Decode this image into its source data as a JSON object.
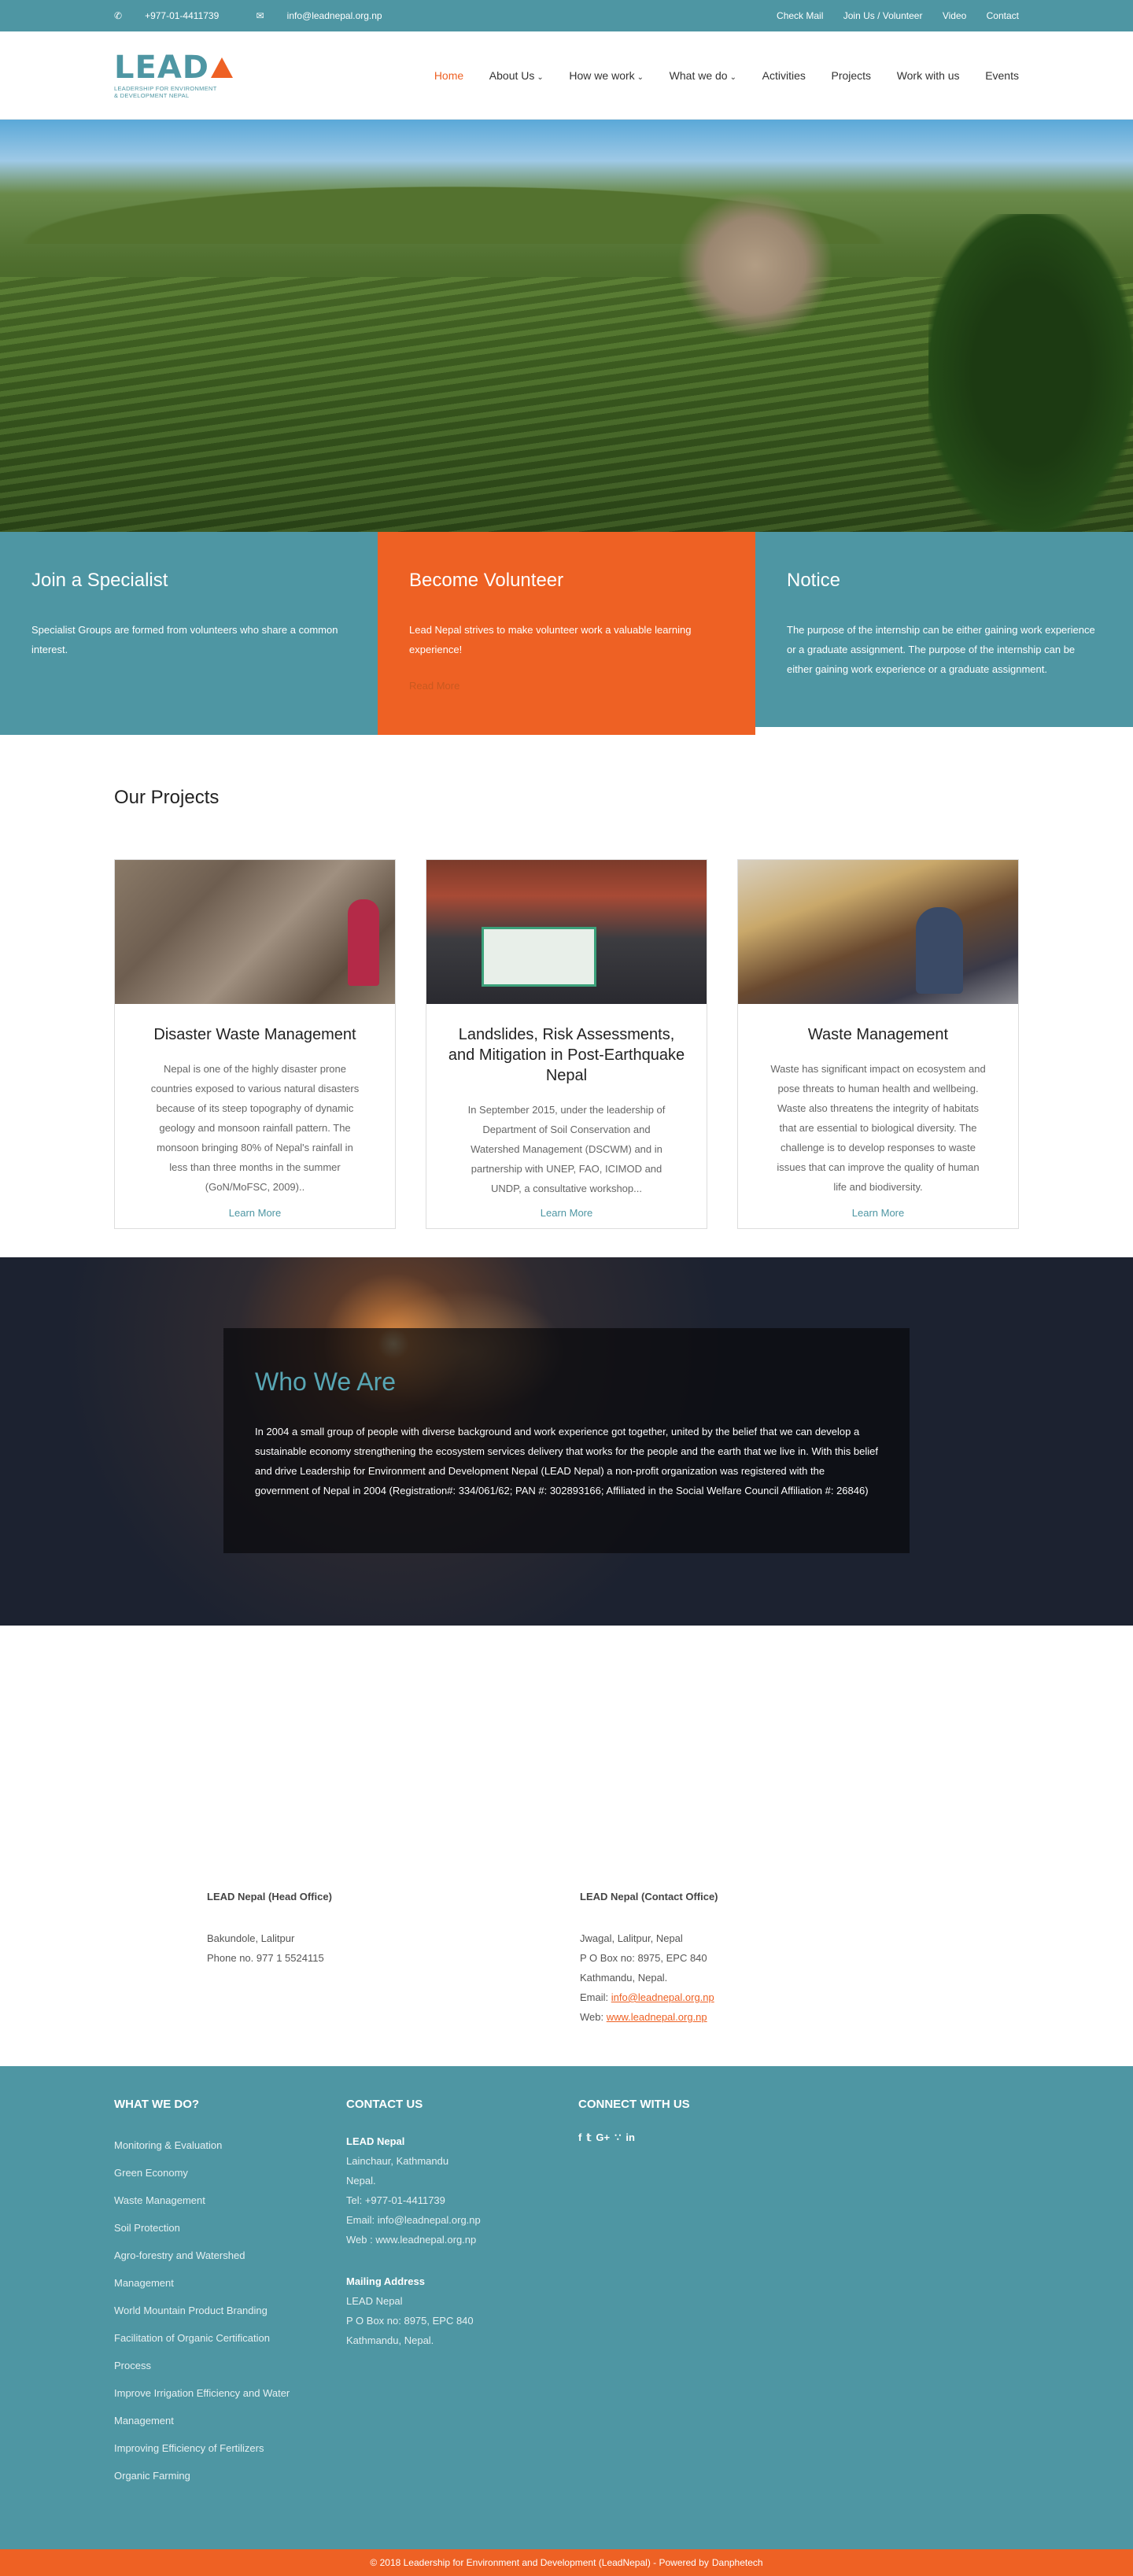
{
  "topbar": {
    "phone": "+977-01-4411739",
    "email": "info@leadnepal.org.np",
    "links": [
      "Check Mail",
      "Join Us / Volunteer",
      "Video",
      "Contact"
    ]
  },
  "logo": {
    "word": "LEAD",
    "line1": "LEADERSHIP FOR ENVIRONMENT",
    "line2": "& DEVELOPMENT NEPAL"
  },
  "nav": {
    "items": [
      {
        "label": "Home",
        "active": true
      },
      {
        "label": "About Us",
        "caret": true
      },
      {
        "label": "How we work",
        "caret": true
      },
      {
        "label": "What we do",
        "caret": true
      },
      {
        "label": "Activities"
      },
      {
        "label": "Projects"
      },
      {
        "label": "Work with us"
      },
      {
        "label": "Events"
      }
    ]
  },
  "boxes": {
    "specialist": {
      "title": "Join a Specialist",
      "text": "Specialist Groups are formed from volunteers who share a common interest."
    },
    "volunteer": {
      "title": "Become Volunteer",
      "text": "Lead Nepal strives to make volunteer work a valuable learning experience!",
      "link": "Read More"
    },
    "notice": {
      "title": "Notice",
      "text": "The purpose of the internship can be either gaining work experience or a graduate assignment. The purpose of the internship can be either gaining work experience or a graduate assignment."
    }
  },
  "projects": {
    "heading": "Our Projects",
    "cards": [
      {
        "title": "Disaster Waste Management",
        "text": "Nepal is one of the highly disaster prone countries exposed to various natural disasters because of its steep topography of dynamic geology and monsoon rainfall pattern. The monsoon bringing 80% of Nepal's rainfall in less than three months in the summer (GoN/MoFSC, 2009)..",
        "link": "Learn More"
      },
      {
        "title": "Landslides, Risk Assessments, and Mitigation in Post-Earthquake Nepal",
        "text": "In September 2015, under the leadership of Department of Soil Conservation and Watershed Management (DSCWM) and in partnership with UNEP, FAO, ICIMOD and UNDP, a consultative workshop...",
        "link": "Learn More"
      },
      {
        "title": "Waste Management",
        "text": "Waste has significant impact on ecosystem and pose threats to human health and wellbeing. Waste also threatens the integrity of habitats that are essential to biological diversity. The challenge is to develop responses to waste issues that can improve the quality of human life and biodiversity.",
        "link": "Learn More"
      }
    ]
  },
  "who": {
    "title": "Who We Are",
    "text": "In 2004 a small group of people with diverse background and work experience got together, united by the belief that we can develop a sustainable economy strengthening the ecosystem services delivery that works for the people and the earth that we live in. With this belief and drive Leadership for Environment and Development Nepal (LEAD Nepal) a non-profit organization was registered with the government of Nepal in 2004 (Registration#: 334/061/62; PAN #: 302893166; Affiliated in the Social Welfare Council Affiliation #: 26846)"
  },
  "offices": {
    "head": {
      "title": "LEAD Nepal (Head Office)",
      "line1": "Bakundole, Lalitpur",
      "line2": "Phone no. 977 1 5524115"
    },
    "contact": {
      "title": "LEAD Nepal (Contact Office)",
      "line1": "Jwagal, Lalitpur, Nepal",
      "line2": "P O Box no: 8975, EPC 840",
      "line3": "Kathmandu, Nepal.",
      "email_label": "Email: ",
      "email": "info@leadnepal.org.np",
      "web_label": "Web: ",
      "web": "www.leadnepal.org.np"
    }
  },
  "footer": {
    "whatwedo": {
      "title": "WHAT WE DO?",
      "items": [
        "Monitoring & Evaluation",
        "Green Economy",
        "Waste Management",
        "Soil Protection",
        "Agro-forestry and Watershed",
        "Management",
        "World Mountain Product Branding",
        "Facilitation of Organic Certification",
        "Process",
        "Improve Irrigation Efficiency and Water",
        "Management",
        "Improving Efficiency of Fertilizers",
        "Organic Farming"
      ]
    },
    "contact": {
      "title": "CONTACT US",
      "org": "LEAD Nepal",
      "addr1": "Lainchaur, Kathmandu",
      "addr2": "Nepal.",
      "tel": "Tel: +977-01-4411739",
      "email": "Email: info@leadnepal.org.np",
      "web": "Web : www.leadnepal.org.np",
      "mail_title": "Mailing Address",
      "mail_org": "LEAD Nepal",
      "mail_box": "P O Box no: 8975, EPC 840",
      "mail_city": "Kathmandu, Nepal."
    },
    "connect": {
      "title": "CONNECT WITH US",
      "icons": [
        "f",
        "t",
        "G+",
        "rss",
        "in"
      ]
    },
    "copyright": "© 2018 Leadership for Environment and Development (LeadNepal) - Powered by",
    "powered": "Danphetech"
  },
  "colors": {
    "teal": "#4e96a3",
    "orange": "#ee6124"
  }
}
